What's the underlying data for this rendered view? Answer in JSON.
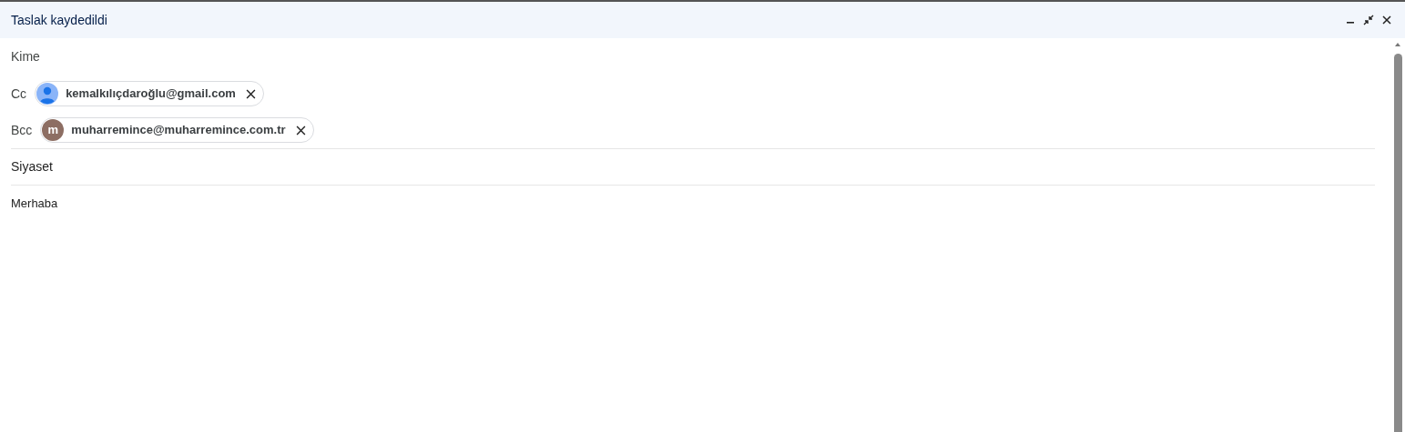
{
  "window": {
    "title": "Taslak kaydedildi"
  },
  "to": {
    "label": "Kime"
  },
  "recipients": [
    {
      "label": "Cc",
      "chips": [
        {
          "avatar": {
            "kind": "person"
          },
          "email": "kemalkılıçdaroğlu@gmail.com"
        }
      ]
    },
    {
      "label": "Bcc",
      "chips": [
        {
          "avatar": {
            "kind": "letter",
            "letter": "m",
            "color": "#8d6e63"
          },
          "email": "muharremince@muharremince.com.tr"
        }
      ]
    }
  ],
  "subject": "Siyaset",
  "body": "Merhaba"
}
